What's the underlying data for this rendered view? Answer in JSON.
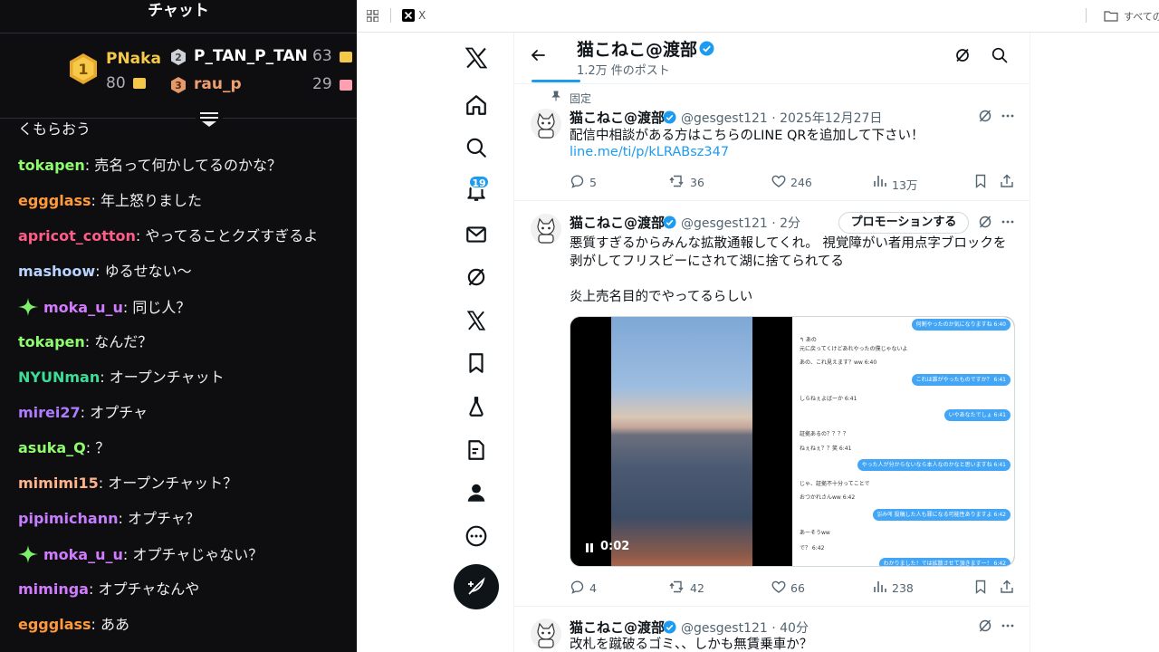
{
  "chat": {
    "title": "チャット",
    "leaderboard": [
      {
        "rank": "1",
        "name": "PNaka",
        "count": "80",
        "color": "#f4c94a"
      },
      {
        "rank": "2",
        "name": "P_TAN_P_TAN",
        "count": "63",
        "color": "#ffffff"
      },
      {
        "rank": "3",
        "name": "rau_p",
        "count": "29",
        "color": "#f0a070"
      }
    ],
    "partial_top": "くもらおう",
    "messages": [
      {
        "user": "tokapen",
        "color": "#8efc6d",
        "text": "売名って何かしてるのかな？",
        "badge": false
      },
      {
        "user": "eggglass",
        "color": "#ff9a3c",
        "text": "年上怒りました",
        "badge": false
      },
      {
        "user": "apricot_cotton",
        "color": "#ff5c8a",
        "text": "やってることクズすぎるよ",
        "badge": false
      },
      {
        "user": "mashoow",
        "color": "#b9d3ff",
        "text": "ゆるせない〜",
        "badge": false
      },
      {
        "user": "moka_u_u",
        "color": "#d27bff",
        "text": "同じ人？",
        "badge": true
      },
      {
        "user": "tokapen",
        "color": "#8efc6d",
        "text": "なんだ？",
        "badge": false
      },
      {
        "user": "NYUNman",
        "color": "#3ddc97",
        "text": "オープンチャット",
        "badge": false
      },
      {
        "user": "mirei27",
        "color": "#b07cff",
        "text": "オプチャ",
        "badge": false
      },
      {
        "user": "asuka_Q",
        "color": "#8efc6d",
        "text": "？",
        "badge": false
      },
      {
        "user": "mimimi15",
        "color": "#ffb38a",
        "text": "オープンチャット？",
        "badge": false
      },
      {
        "user": "pipimichann",
        "color": "#c77dff",
        "text": "オプチャ？",
        "badge": false
      },
      {
        "user": "moka_u_u",
        "color": "#d27bff",
        "text": "オプチャじゃない？",
        "badge": true
      },
      {
        "user": "mimingа",
        "color": "#d27bff",
        "text": "オプチャなんや",
        "badge": false
      },
      {
        "user": "eggglass",
        "color": "#ff9a3c",
        "text": "ああ",
        "badge": false
      }
    ],
    "sep": ": "
  },
  "browser": {
    "tab_label": "X",
    "bookmarks_label": "すべてのブ"
  },
  "x": {
    "notif_count": "19",
    "profile": {
      "name": "猫こねこ@渡部",
      "post_count": "1.2万 件のポスト"
    },
    "pinned_label": "固定",
    "tweets": [
      {
        "name": "猫こねこ@渡部",
        "meta": "@gesgest121 · 2025年12月27日",
        "text": "配信中相談がある方はこちらのLINE QRを追加して下さい！",
        "link": "line.me/ti/p/kLRABsz347",
        "replies": "5",
        "reposts": "36",
        "likes": "246",
        "views": "13万"
      },
      {
        "name": "猫こねこ@渡部",
        "meta": "@gesgest121 · 2分",
        "promote": "プロモーションする",
        "text1": "悪質すぎるからみんな拡散通報してくれ。 視覚障がい者用点字ブロックを剥がしてフリスビーにされて湖に捨てられてる",
        "text2": "炎上売名目的でやってるらしい",
        "video_time": "0:02",
        "replies": "4",
        "reposts": "42",
        "likes": "66",
        "views": "238"
      },
      {
        "name": "猫こねこ@渡部",
        "meta": "@gesgest121 · 40分",
        "text": "改札を蹴破るゴミ、、しかも無賃乗車か？"
      }
    ],
    "screenshot_chat": {
      "right": [
        "何割やったのか気になりますね 6:40",
        "これは誰がやったものですか？ 6:41",
        "いやあなたでしょ 6:41",
        "やった人が分からないなら本人なのかなと思いますね 6:41",
        "읽み에 投稿した人も罪になる可能性ありますよ 6:42",
        "わかりました！では拡散させて頂きますー！ 6:42"
      ],
      "left": [
        "↰ あの",
        "元に戻ってくけどあれやったの僕じゃないよ",
        "あの、これ見えます？ww 6:40",
        "しらねぇよばーか 6:41",
        "証拠あるの？？？？",
        "ねぇねぇ？？笑 6:41",
        "じゃ、証拠不十分ってことで",
        "おつかれさんww 6:42",
        "あーそうww",
        "で？ 6:42"
      ]
    }
  }
}
